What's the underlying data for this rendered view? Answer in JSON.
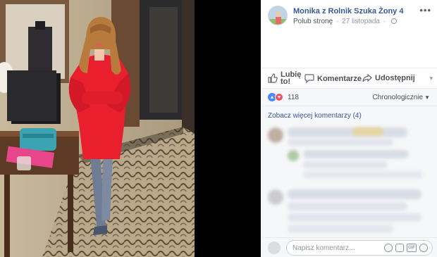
{
  "post": {
    "page_name": "Monika z Rolnik Szuka Żony 4",
    "like_page_label": "Polub stronę",
    "separator": "·",
    "date": "27 listopada",
    "more_label": "•••"
  },
  "actions": {
    "like_label": "Lubię to!",
    "comment_label": "Komentarze",
    "share_label": "Udostępnij",
    "more_caret": "▾"
  },
  "reactions": {
    "like_glyph": "▲",
    "love_glyph": "♥",
    "count": "118",
    "sort_label": "Chronologicznie",
    "sort_caret": "▼"
  },
  "comments": {
    "see_more": "Zobacz więcej komentarzy (4)"
  },
  "composer": {
    "placeholder": "Napisz komentarz...",
    "gif_label": "GIF"
  },
  "icons": [
    "thumbs-up-icon",
    "speech-bubble-icon",
    "share-arrow-icon",
    "globe-icon",
    "more-icon",
    "emoji-icon",
    "camera-icon",
    "gif-icon",
    "sticker-icon"
  ],
  "colors": {
    "link_blue": "#365899",
    "text_gray": "#4b4f56",
    "muted_gray": "#90949c",
    "panel_bg": "#f6f7f9",
    "like_blue": "#4c8bf5",
    "love_red": "#f25268"
  }
}
